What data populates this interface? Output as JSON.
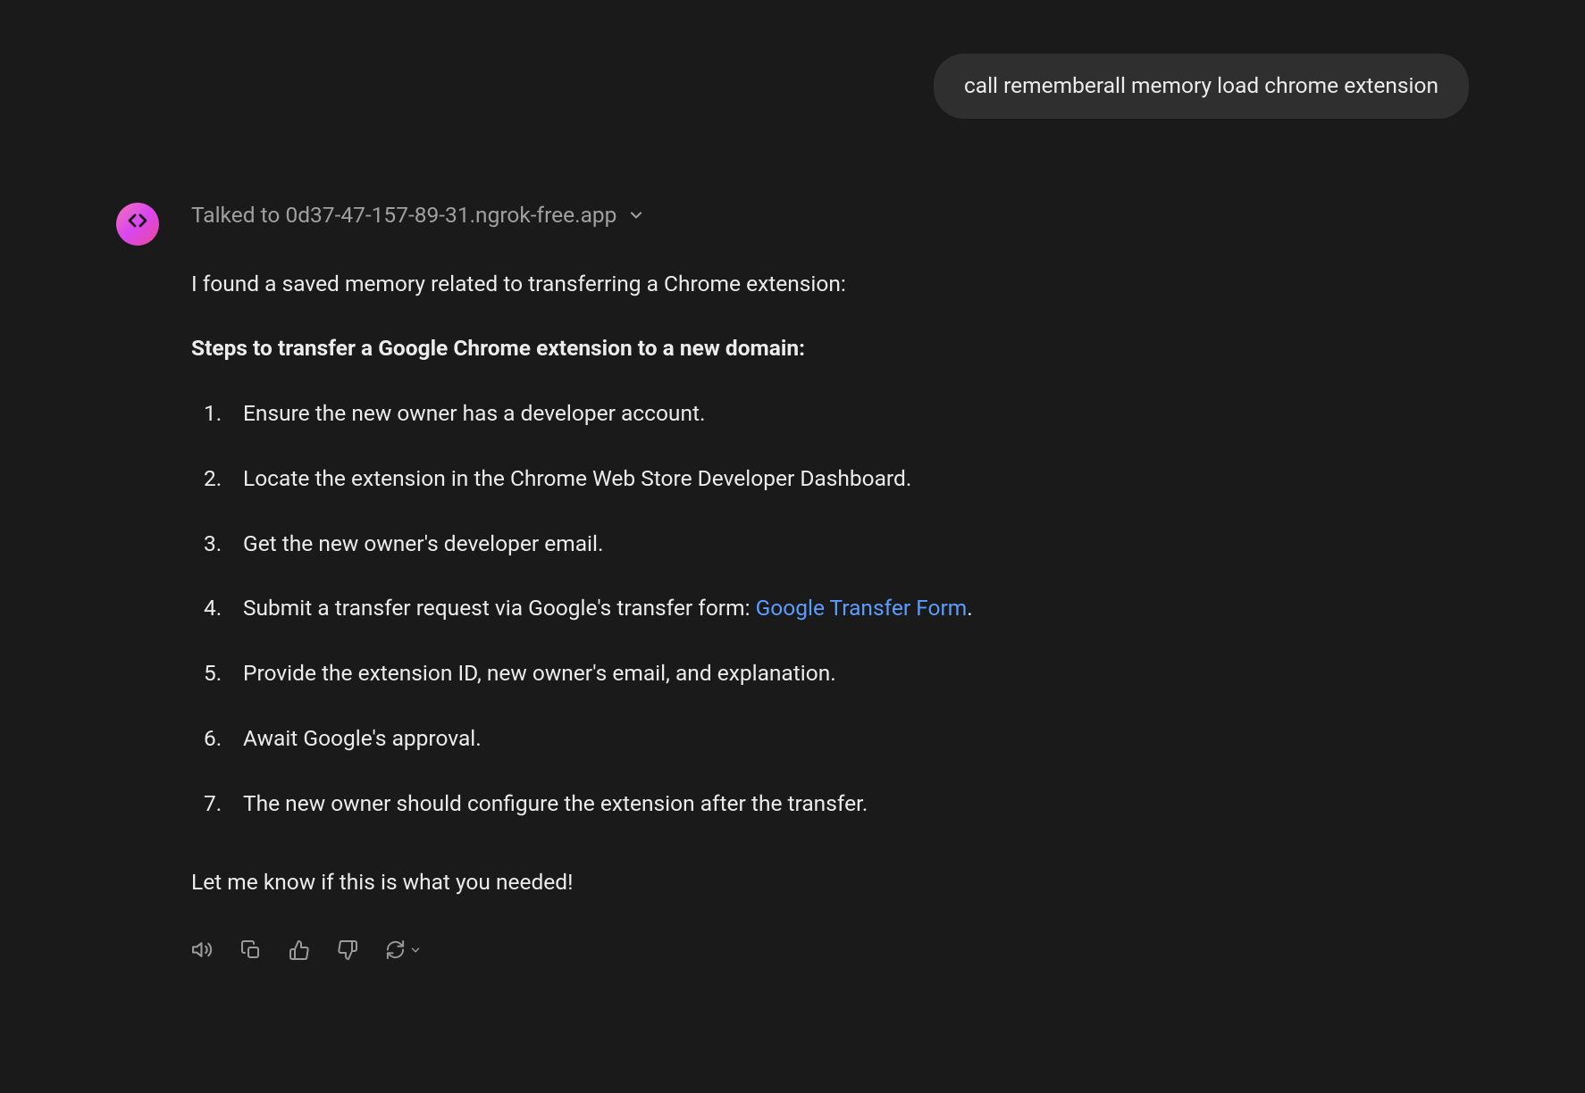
{
  "user_message": "call rememberall memory load chrome extension",
  "talked_to": {
    "prefix": "Talked to ",
    "host": "0d37-47-157-89-31.ngrok-free.app"
  },
  "assistant": {
    "intro": "I found a saved memory related to transferring a Chrome extension:",
    "steps_heading": "Steps to transfer a Google Chrome extension to a new domain:",
    "steps": [
      "Ensure the new owner has a developer account.",
      "Locate the extension in the Chrome Web Store Developer Dashboard.",
      "Get the new owner's developer email.",
      "Submit a transfer request via Google's transfer form: ",
      "Provide the extension ID, new owner's email, and explanation.",
      "Await Google's approval.",
      "The new owner should configure the extension after the transfer."
    ],
    "link_text": "Google Transfer Form",
    "link_suffix": ".",
    "closing": "Let me know if this is what you needed!"
  },
  "avatar_glyph": "< >",
  "actions": {
    "speak": "speak-aloud",
    "copy": "copy",
    "thumbs_up": "thumbs-up",
    "thumbs_down": "thumbs-down",
    "regenerate": "regenerate"
  }
}
